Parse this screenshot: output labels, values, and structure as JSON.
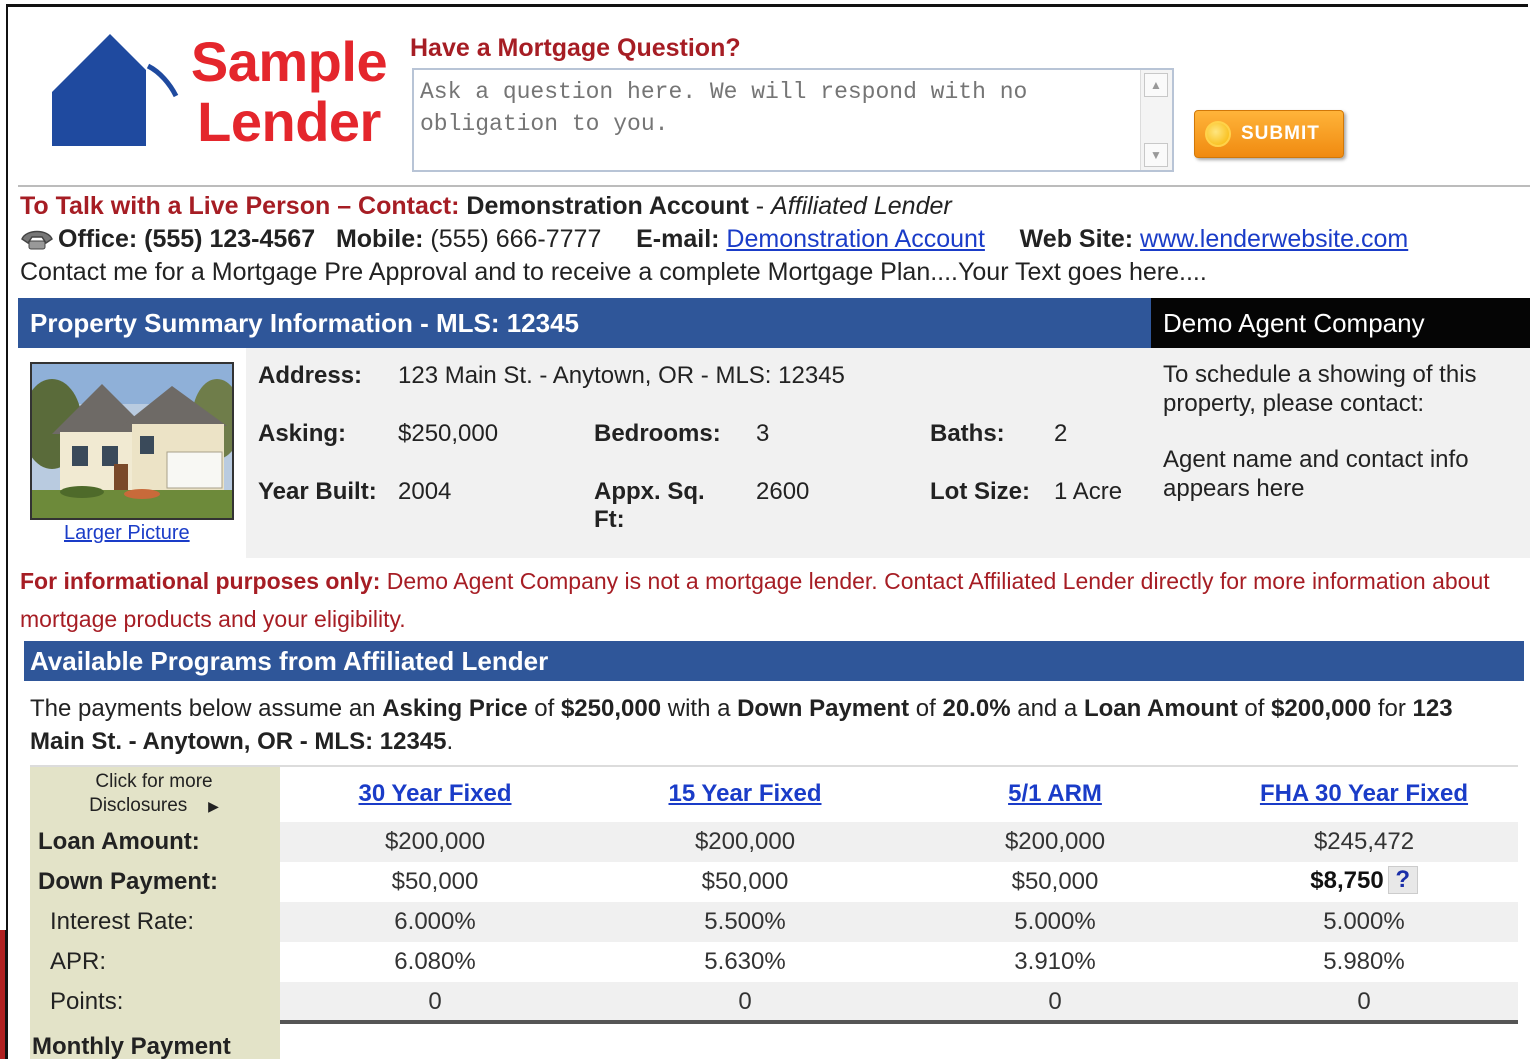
{
  "brand": {
    "logo_line1": "Sample",
    "logo_line2": "Lender",
    "color_red": "#e4262c",
    "color_blue": "#1f4a9f"
  },
  "question": {
    "title": "Have a Mortgage Question?",
    "placeholder": "Ask a question here. We will respond with no obligation to you.",
    "submit_label": "SUBMIT"
  },
  "contact": {
    "heading": "To Talk with a Live Person – Contact:",
    "name": "Demonstration Account",
    "separator": " - ",
    "role": "Affiliated Lender",
    "office_label": "Office:",
    "office_value": "(555) 123-4567",
    "mobile_label": "Mobile:",
    "mobile_value": "(555) 666-7777",
    "email_label": "E-mail:",
    "email_link": "Demonstration Account",
    "website_label": "Web Site:",
    "website_link": "www.lenderwebsite.com",
    "message": "Contact me for a Mortgage Pre Approval and to receive a complete Mortgage Plan....Your Text goes here...."
  },
  "property": {
    "bar_title": "Property Summary Information - MLS: 12345",
    "larger_picture": "Larger Picture",
    "address_label": "Address:",
    "address_value": "123 Main St. - Anytown, OR - MLS: 12345",
    "asking_label": "Asking:",
    "asking_value": "$250,000",
    "bedrooms_label": "Bedrooms:",
    "bedrooms_value": "3",
    "baths_label": "Baths:",
    "baths_value": "2",
    "year_label": "Year Built:",
    "year_value": "2004",
    "sqft_label": "Appx. Sq. Ft:",
    "sqft_value": "2600",
    "lot_label": "Lot Size:",
    "lot_value": "1 Acre"
  },
  "agent": {
    "company": "Demo Agent Company",
    "schedule_text": "To schedule a showing of this property, please contact:",
    "info_text": "Agent name and contact info appears here"
  },
  "disclaimer": {
    "lead": "For informational purposes only:",
    "text": " Demo Agent Company is not a mortgage lender. Contact Affiliated Lender directly for more information about mortgage products and your eligibility."
  },
  "programs": {
    "bar_title": "Available Programs from Affiliated Lender",
    "intro": {
      "t1": "The payments below assume an ",
      "b1": "Asking Price",
      "t2": " of ",
      "b2": "$250,000",
      "t3": " with a ",
      "b3": "Down Payment",
      "t4": " of ",
      "b4": "20.0%",
      "t5": " and a ",
      "b5": "Loan Amount",
      "t6": " of ",
      "b6": "$200,000",
      "t7": " for ",
      "b7": "123 Main St. - Anytown, OR - MLS: 12345",
      "t8": "."
    },
    "disclosures_line1": "Click for more",
    "disclosures_line2": "Disclosures",
    "columns": [
      "30 Year Fixed",
      "15 Year Fixed",
      "5/1 ARM",
      "FHA 30 Year Fixed"
    ],
    "rows": {
      "loan_amount": {
        "label": "Loan Amount:",
        "values": [
          "$200,000",
          "$200,000",
          "$200,000",
          "$245,472"
        ]
      },
      "down_payment": {
        "label": "Down Payment:",
        "values": [
          "$50,000",
          "$50,000",
          "$50,000",
          "$8,750"
        ]
      },
      "interest_rate": {
        "label": "Interest Rate:",
        "values": [
          "6.000%",
          "5.500%",
          "5.000%",
          "5.000%"
        ]
      },
      "apr": {
        "label": "APR:",
        "values": [
          "6.080%",
          "5.630%",
          "3.910%",
          "5.980%"
        ]
      },
      "points": {
        "label": "Points:",
        "values": [
          "0",
          "0",
          "0",
          "0"
        ]
      }
    },
    "monthly_label": "Monthly Payment"
  }
}
